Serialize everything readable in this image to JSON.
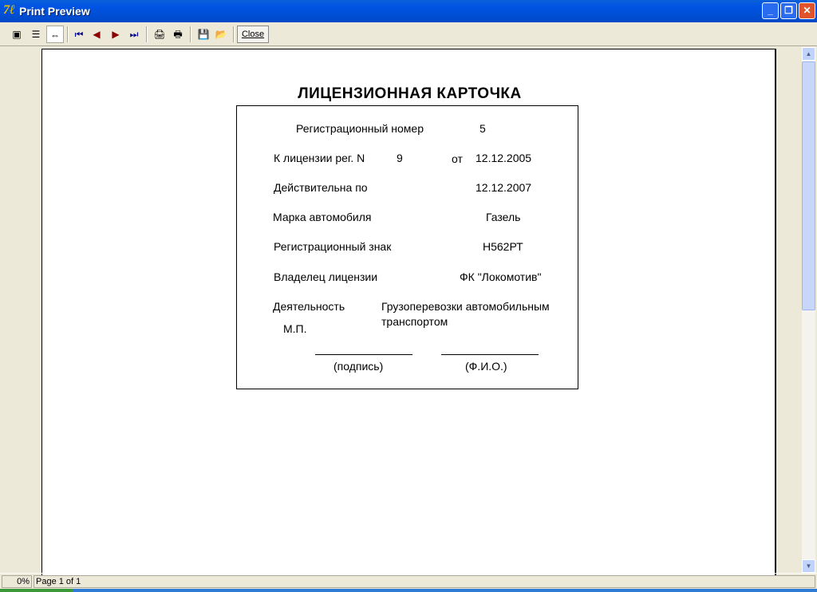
{
  "window": {
    "title": "Print Preview"
  },
  "toolbar": {
    "close_label": "Close"
  },
  "document": {
    "title": "ЛИЦЕНЗИОННАЯ КАРТОЧКА",
    "reg_number_label": "Регистрационный номер",
    "reg_number": "5",
    "license_label": "К лицензии рег. N",
    "license_number": "9",
    "from_label": "от",
    "license_date": "12.12.2005",
    "valid_label": "Действительна по",
    "valid_date": "12.12.2007",
    "car_label": "Марка автомобиля",
    "car": "Газель",
    "plate_label": "Регистрационный знак",
    "plate": "Н562РТ",
    "owner_label": "Владелец лицензии",
    "owner": "ФК \"Локомотив\"",
    "activity_label": "Деятельность",
    "activity_line1": "Грузоперевозки автомобильным",
    "activity_line2": "транспортом",
    "stamp_label": "М.П.",
    "signature_label": "(подпись)",
    "name_label": "(Ф.И.О.)"
  },
  "status": {
    "progress": "0%",
    "page": "Page 1 of 1"
  }
}
